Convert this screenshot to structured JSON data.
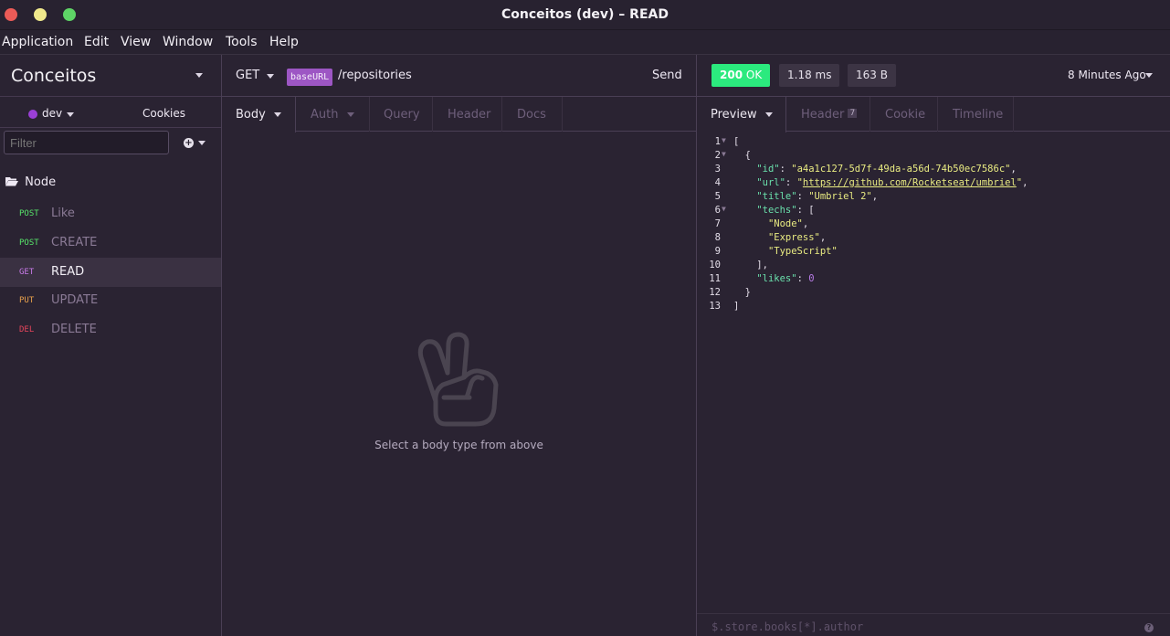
{
  "window": {
    "title": "Conceitos (dev) – READ"
  },
  "menu": [
    "Application",
    "Edit",
    "View",
    "Window",
    "Tools",
    "Help"
  ],
  "sidebar": {
    "workspace": "Conceitos",
    "environment": "dev",
    "cookies": "Cookies",
    "filter_placeholder": "Filter",
    "folder": "Node",
    "requests": [
      {
        "method": "POST",
        "name": "Like",
        "color": "#57e66a"
      },
      {
        "method": "POST",
        "name": "CREATE",
        "color": "#57e66a"
      },
      {
        "method": "GET",
        "name": "READ",
        "color": "#c87ae8",
        "active": true
      },
      {
        "method": "PUT",
        "name": "UPDATE",
        "color": "#eaa24c"
      },
      {
        "method": "DEL",
        "name": "DELETE",
        "color": "#e6455c"
      }
    ]
  },
  "request": {
    "method": "GET",
    "base_var": "baseURL",
    "path": "/repositories",
    "send": "Send",
    "tabs": [
      "Body",
      "Auth",
      "Query",
      "Header",
      "Docs"
    ],
    "empty_message": "Select a body type from above",
    "empty_icon": "peace-hand-icon"
  },
  "response": {
    "status": "200 OK",
    "status_code": "200",
    "status_text": "OK",
    "time": "1.18 ms",
    "size": "163 B",
    "ago": "8 Minutes Ago",
    "tabs": [
      "Preview",
      "Header",
      "Cookie",
      "Timeline"
    ],
    "header_count": "7",
    "filter_placeholder": "$.store.books[*].author",
    "lines": [
      {
        "n": "1",
        "fold": true,
        "t": [
          [
            "p",
            "["
          ]
        ]
      },
      {
        "n": "2",
        "fold": true,
        "t": [
          [
            "p",
            "  {"
          ]
        ]
      },
      {
        "n": "3",
        "t": [
          [
            "p",
            "    "
          ],
          [
            "k",
            "\"id\""
          ],
          [
            "p",
            ": "
          ],
          [
            "s",
            "\"a4a1c127-5d7f-49da-a56d-74b50ec7586c\""
          ],
          [
            "p",
            ","
          ]
        ]
      },
      {
        "n": "4",
        "t": [
          [
            "p",
            "    "
          ],
          [
            "k",
            "\"url\""
          ],
          [
            "p",
            ": "
          ],
          [
            "s",
            "\""
          ],
          [
            "u",
            "https://github.com/Rocketseat/umbriel"
          ],
          [
            "s",
            "\""
          ],
          [
            "p",
            ","
          ]
        ]
      },
      {
        "n": "5",
        "t": [
          [
            "p",
            "    "
          ],
          [
            "k",
            "\"title\""
          ],
          [
            "p",
            ": "
          ],
          [
            "s",
            "\"Umbriel 2\""
          ],
          [
            "p",
            ","
          ]
        ]
      },
      {
        "n": "6",
        "fold": true,
        "t": [
          [
            "p",
            "    "
          ],
          [
            "k",
            "\"techs\""
          ],
          [
            "p",
            ": ["
          ]
        ]
      },
      {
        "n": "7",
        "t": [
          [
            "p",
            "      "
          ],
          [
            "s",
            "\"Node\""
          ],
          [
            "p",
            ","
          ]
        ]
      },
      {
        "n": "8",
        "t": [
          [
            "p",
            "      "
          ],
          [
            "s",
            "\"Express\""
          ],
          [
            "p",
            ","
          ]
        ]
      },
      {
        "n": "9",
        "t": [
          [
            "p",
            "      "
          ],
          [
            "s",
            "\"TypeScript\""
          ]
        ]
      },
      {
        "n": "10",
        "t": [
          [
            "p",
            "    ],"
          ]
        ]
      },
      {
        "n": "11",
        "t": [
          [
            "p",
            "    "
          ],
          [
            "k",
            "\"likes\""
          ],
          [
            "p",
            ": "
          ],
          [
            "n",
            "0"
          ]
        ]
      },
      {
        "n": "12",
        "t": [
          [
            "p",
            "  }"
          ]
        ]
      },
      {
        "n": "13",
        "t": [
          [
            "p",
            "]"
          ]
        ]
      }
    ]
  },
  "colors": {
    "background": "#2a2332",
    "status_ok": "#2bea7e",
    "accent": "#9d56c4"
  }
}
